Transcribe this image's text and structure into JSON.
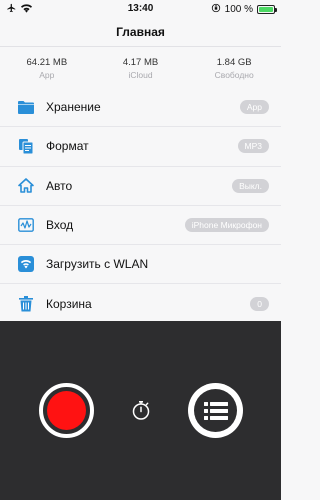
{
  "status_bar": {
    "time": "13:40",
    "battery_text": "100 %",
    "battery_level": 1.0,
    "icons": [
      "airplane-icon",
      "wifi-icon",
      "orientation-lock-icon",
      "battery-icon"
    ]
  },
  "nav": {
    "title": "Главная"
  },
  "stats": [
    {
      "value": "64.21 MB",
      "label": "App"
    },
    {
      "value": "4.17 MB",
      "label": "iCloud"
    },
    {
      "value": "1.84 GB",
      "label": "Свободно"
    }
  ],
  "menu": [
    {
      "label": "Хранение",
      "badge": "App",
      "icon": "folder-icon"
    },
    {
      "label": "Формат",
      "badge": "MP3",
      "icon": "files-icon"
    },
    {
      "label": "Авто",
      "badge": "Выкл.",
      "icon": "home-icon"
    },
    {
      "label": "Вход",
      "badge": "iPhone Микрофон",
      "icon": "waveform-icon"
    },
    {
      "label": "Загрузить с WLAN",
      "badge": "",
      "icon": "wifi-icon"
    },
    {
      "label": "Корзина",
      "badge": "0",
      "icon": "trash-icon"
    }
  ],
  "colors": {
    "accent": "#2a8fd8",
    "record": "#ff1212",
    "panel": "#2d2d2f",
    "badge": "#d2d2d6"
  }
}
